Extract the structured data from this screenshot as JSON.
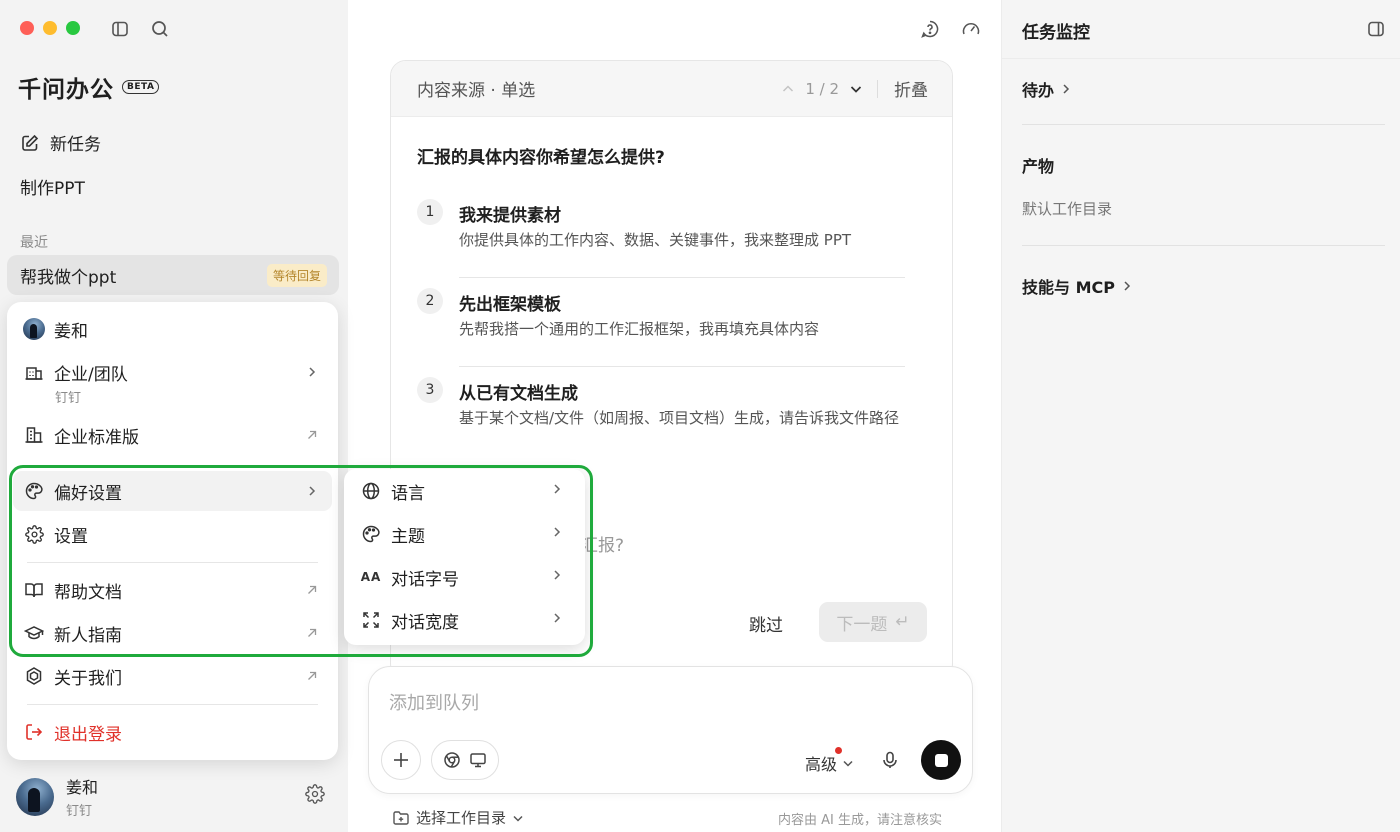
{
  "sidebar": {
    "brand": "千问办公",
    "beta": "BETA",
    "new_task": "新任务",
    "make_ppt": "制作PPT",
    "recent_label": "最近",
    "recent_item": {
      "title": "帮我做个ppt",
      "badge": "等待回复"
    },
    "user": {
      "name": "姜和",
      "org": "钉钉"
    }
  },
  "user_menu": {
    "name": "姜和",
    "team": {
      "label": "企业/团队",
      "sub": "钉钉"
    },
    "enterprise": "企业标准版",
    "preferences": "偏好设置",
    "settings": "设置",
    "help_docs": "帮助文档",
    "guide": "新人指南",
    "about": "关于我们",
    "logout": "退出登录"
  },
  "submenu": {
    "language": "语言",
    "theme": "主题",
    "font_size": "对话字号",
    "width": "对话宽度",
    "font_size_glyph": "AA"
  },
  "question": {
    "source": "内容来源 · 单选",
    "pager": "1 / 2",
    "fold": "折叠",
    "title": "汇报的具体内容你希望怎么提供?",
    "options": [
      {
        "num": "1",
        "title": "我来提供素材",
        "desc": "你提供具体的工作内容、数据、关键事件，我来整理成 PPT"
      },
      {
        "num": "2",
        "title": "先出框架模板",
        "desc": "先帮我搭一个通用的工作汇报框架，我再填充具体内容"
      },
      {
        "num": "3",
        "title": "从已有文档生成",
        "desc": "基于某个文档/文件（如周报、项目文档）生成，请告诉我文件路径"
      }
    ],
    "other_partial": "汇报?",
    "skip": "跳过",
    "next": "下一题",
    "next_key": "↵"
  },
  "composer": {
    "placeholder": "添加到队列",
    "advanced": "高级",
    "workdir": "选择工作目录",
    "disclaimer": "内容由 AI 生成，请注意核实"
  },
  "right_panel": {
    "title": "任务监控",
    "todo": "待办",
    "artifacts": "产物",
    "default_dir": "默认工作目录",
    "skills": "技能与 MCP"
  },
  "colors": {
    "highlight": "#1faa3c",
    "logout": "#e0312a",
    "badge_bg": "#faecc8",
    "badge_text": "#b4862c"
  }
}
